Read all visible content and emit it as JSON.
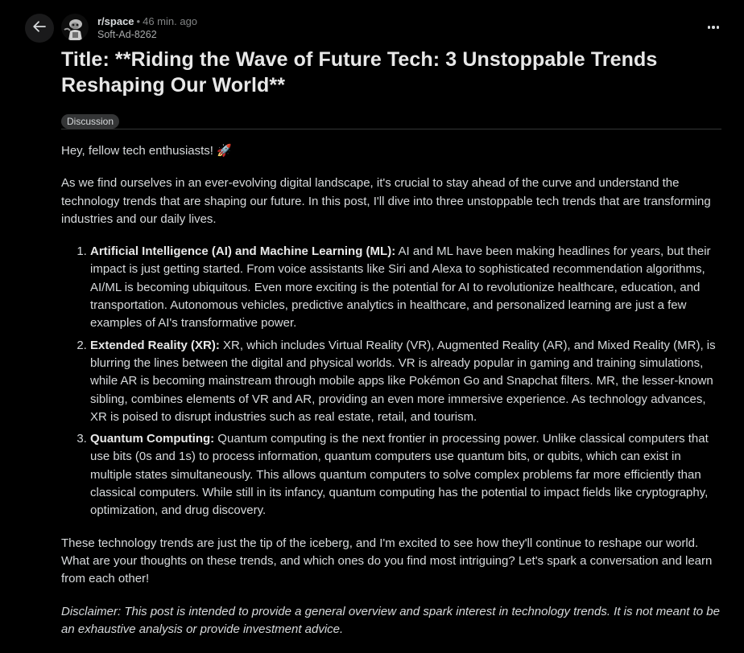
{
  "header": {
    "subreddit": "r/space",
    "separator": "•",
    "time": "46 min. ago",
    "author": "Soft-Ad-8262",
    "back_icon": "arrow-left-icon",
    "more_icon": "ellipsis-icon"
  },
  "post": {
    "title": "Title: **Riding the Wave of Future Tech: 3 Unstoppable Trends Reshaping Our World**",
    "flair": "Discussion",
    "greeting": "Hey, fellow tech enthusiasts! 🚀",
    "intro": "As we find ourselves in an ever-evolving digital landscape, it's crucial to stay ahead of the curve and understand the technology trends that are shaping our future. In this post, I'll dive into three unstoppable tech trends that are transforming industries and our daily lives.",
    "trends": [
      {
        "heading": "Artificial Intelligence (AI) and Machine Learning (ML):",
        "text": " AI and ML have been making headlines for years, but their impact is just getting started. From voice assistants like Siri and Alexa to sophisticated recommendation algorithms, AI/ML is becoming ubiquitous. Even more exciting is the potential for AI to revolutionize healthcare, education, and transportation. Autonomous vehicles, predictive analytics in healthcare, and personalized learning are just a few examples of AI's transformative power."
      },
      {
        "heading": "Extended Reality (XR):",
        "text": " XR, which includes Virtual Reality (VR), Augmented Reality (AR), and Mixed Reality (MR), is blurring the lines between the digital and physical worlds. VR is already popular in gaming and training simulations, while AR is becoming mainstream through mobile apps like Pokémon Go and Snapchat filters. MR, the lesser-known sibling, combines elements of VR and AR, providing an even more immersive experience. As technology advances, XR is poised to disrupt industries such as real estate, retail, and tourism."
      },
      {
        "heading": "Quantum Computing:",
        "text": " Quantum computing is the next frontier in processing power. Unlike classical computers that use bits (0s and 1s) to process information, quantum computers use quantum bits, or qubits, which can exist in multiple states simultaneously. This allows quantum computers to solve complex problems far more efficiently than classical computers. While still in its infancy, quantum computing has the potential to impact fields like cryptography, optimization, and drug discovery."
      }
    ],
    "closing": "These technology trends are just the tip of the iceberg, and I'm excited to see how they'll continue to reshape our world. What are your thoughts on these trends, and which ones do you find most intriguing? Let's spark a conversation and learn from each other!",
    "disclaimer": "Disclaimer: This post is intended to provide a general overview and spark interest in technology trends. It is not meant to be an exhaustive analysis or provide investment advice."
  }
}
